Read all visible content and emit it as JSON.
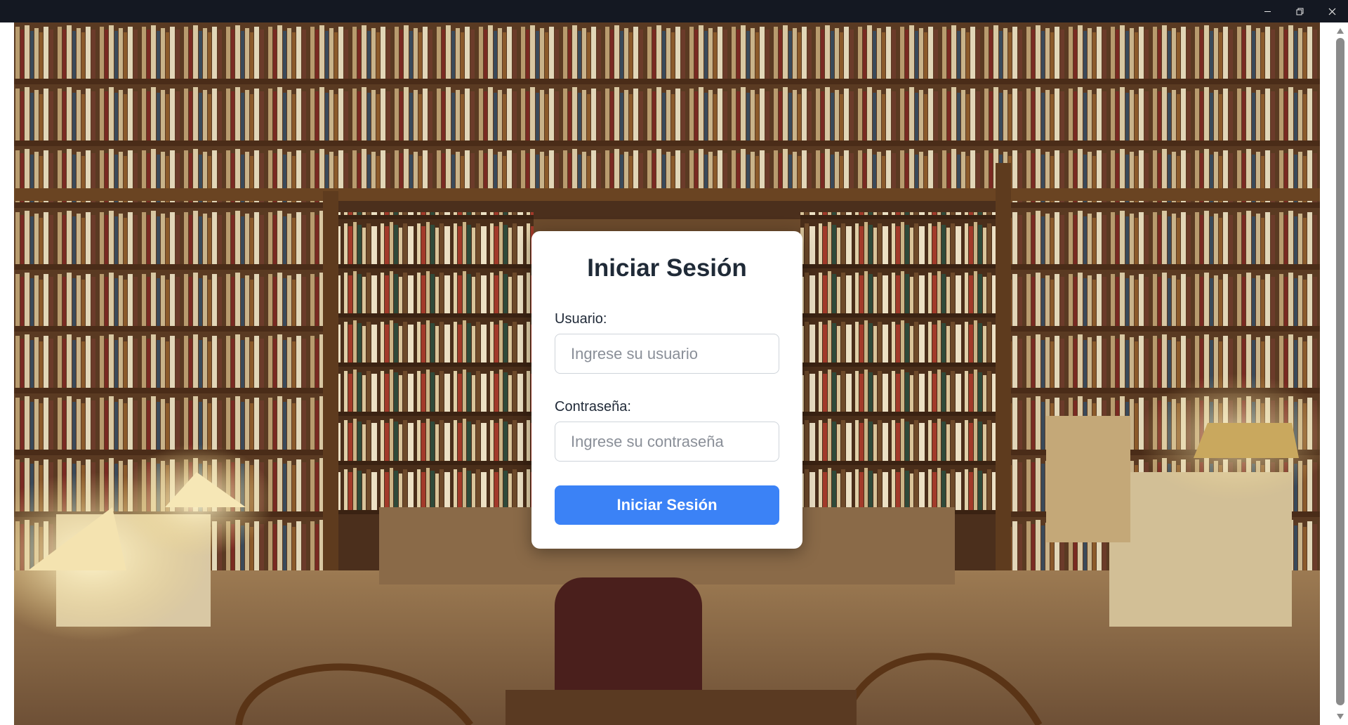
{
  "window": {
    "minimize_icon": "minimize-icon",
    "restore_icon": "restore-icon",
    "close_icon": "close-icon"
  },
  "background": {
    "description_icon": "library-bookshelves-photo"
  },
  "login": {
    "title": "Iniciar Sesión",
    "username_label": "Usuario:",
    "username_placeholder": "Ingrese su usuario",
    "username_value": "",
    "password_label": "Contraseña:",
    "password_placeholder": "Ingrese su contraseña",
    "password_value": "",
    "submit_label": "Iniciar Sesión"
  },
  "colors": {
    "titlebar": "#141822",
    "button": "#3b82f6",
    "card": "#ffffff",
    "title_text": "#1f2a37"
  }
}
